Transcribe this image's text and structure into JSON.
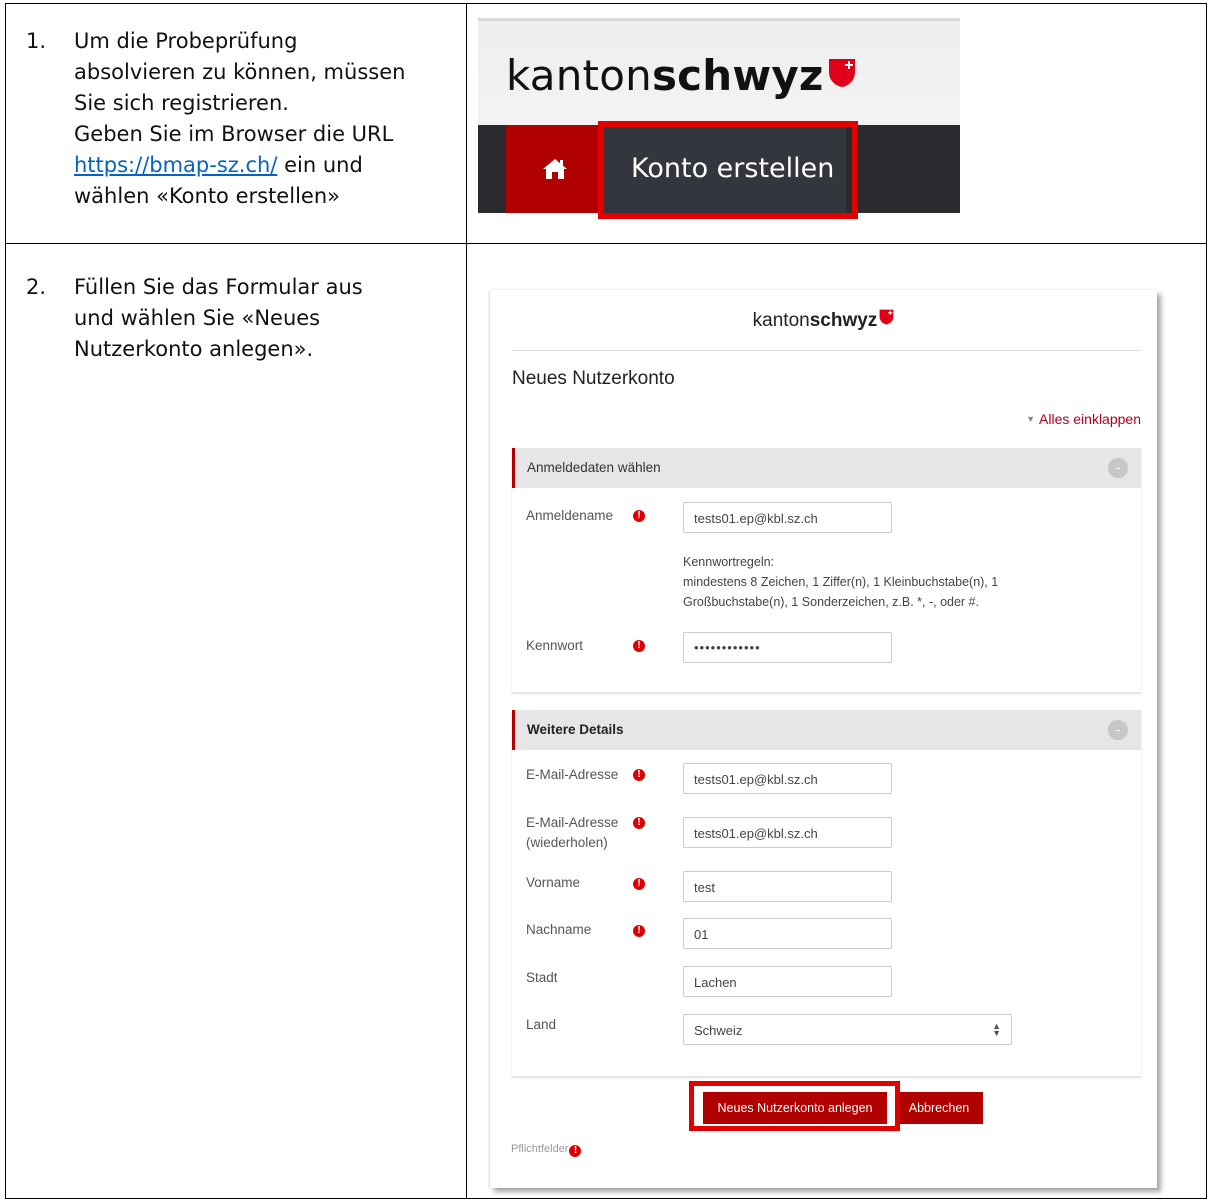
{
  "steps": [
    {
      "number": "1.",
      "lines": [
        "Um die Probeprüfung",
        "absolvieren zu können, müssen",
        "Sie sich registrieren.",
        "Geben Sie im Browser die URL"
      ],
      "link": "https://bmap-sz.ch/",
      "link_suffix": " ein und",
      "last_line": "wählen «Konto erstellen»"
    },
    {
      "number": "2.",
      "lines": [
        "Füllen Sie das Formular aus",
        "und wählen Sie «Neues",
        "Nutzerkonto anlegen»."
      ]
    }
  ],
  "header_shot": {
    "logo_regular": "kanton",
    "logo_bold": "schwyz",
    "nav_item": "Konto erstellen",
    "home_icon": "home-icon",
    "colors": {
      "brand_red": "#b10000",
      "navbar": "#2b2b2f",
      "highlight": "#e30000"
    }
  },
  "form_shot": {
    "logo_regular": "kanton",
    "logo_bold": "schwyz",
    "title": "Neues Nutzerkonto",
    "collapse_all": "Alles einklappen",
    "section1": {
      "title": "Anmeldedaten wählen",
      "toggle": "-",
      "username_label": "Anmeldename",
      "username_value": "tests01.ep@kbl.sz.ch",
      "rules_title": "Kennwortregeln:",
      "rules_line1": "mindestens 8 Zeichen, 1 Ziffer(n), 1 Kleinbuchstabe(n), 1",
      "rules_line2": "Großbuchstabe(n), 1 Sonderzeichen, z.B. *, -, oder #.",
      "password_label": "Kennwort",
      "password_value": "••••••••••••"
    },
    "section2": {
      "title": "Weitere Details",
      "toggle": "-",
      "email_label": "E-Mail-Adresse",
      "email_value": "tests01.ep@kbl.sz.ch",
      "email2_label1": "E-Mail-Adresse",
      "email2_label2": "(wiederholen)",
      "email2_value": "tests01.ep@kbl.sz.ch",
      "firstname_label": "Vorname",
      "firstname_value": "test",
      "lastname_label": "Nachname",
      "lastname_value": "01",
      "city_label": "Stadt",
      "city_value": "Lachen",
      "country_label": "Land",
      "country_value": "Schweiz"
    },
    "submit_label": "Neues Nutzerkonto anlegen",
    "cancel_label": "Abbrechen",
    "required_note": "Pflichtfelder",
    "required_icon": "!"
  }
}
